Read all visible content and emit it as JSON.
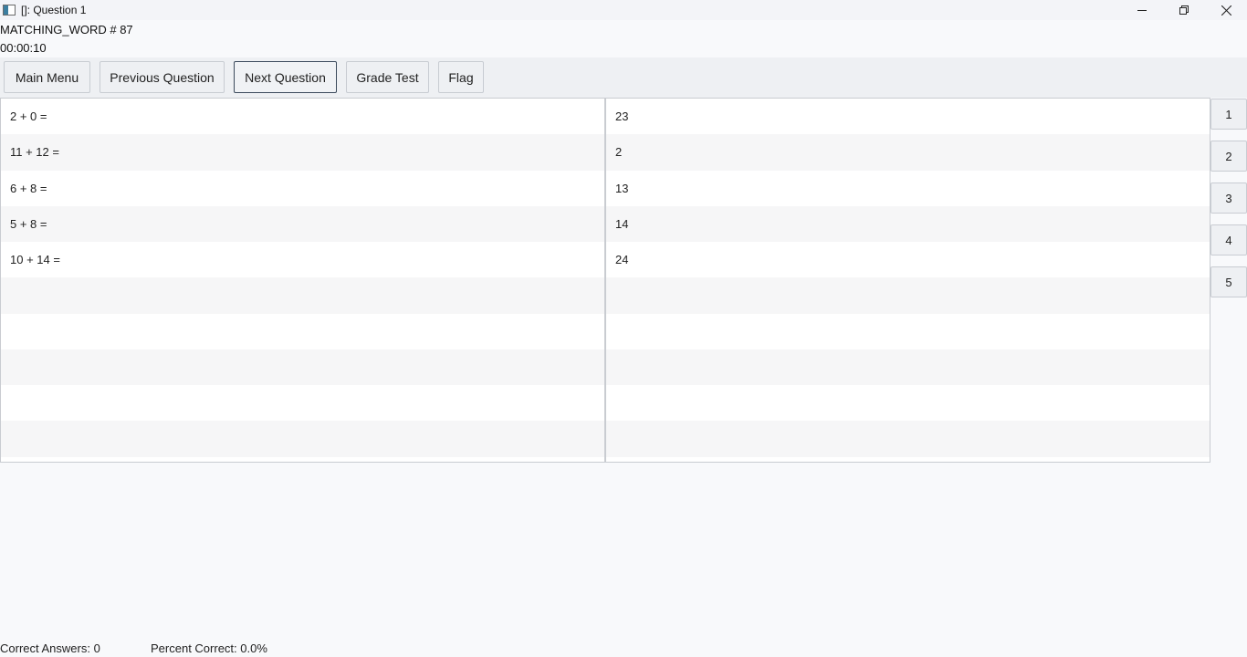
{
  "window": {
    "title": "[]: Question 1"
  },
  "header": {
    "quiz_label": "MATCHING_WORD # 87",
    "timer": "00:00:10"
  },
  "toolbar": {
    "main_menu": "Main Menu",
    "previous_question": "Previous Question",
    "next_question": "Next Question",
    "grade_test": "Grade Test",
    "flag": "Flag"
  },
  "questions": [
    "2 + 0 =",
    "11 + 12 =",
    "6 + 8 =",
    "5 + 8 =",
    "10 + 14 ="
  ],
  "answers": [
    "23",
    "2",
    "13",
    "14",
    "24"
  ],
  "question_nav": [
    "1",
    "2",
    "3",
    "4",
    "5"
  ],
  "footer": {
    "correct_answers": "Correct Answers: 0",
    "percent_correct": "Percent Correct: 0.0%"
  }
}
